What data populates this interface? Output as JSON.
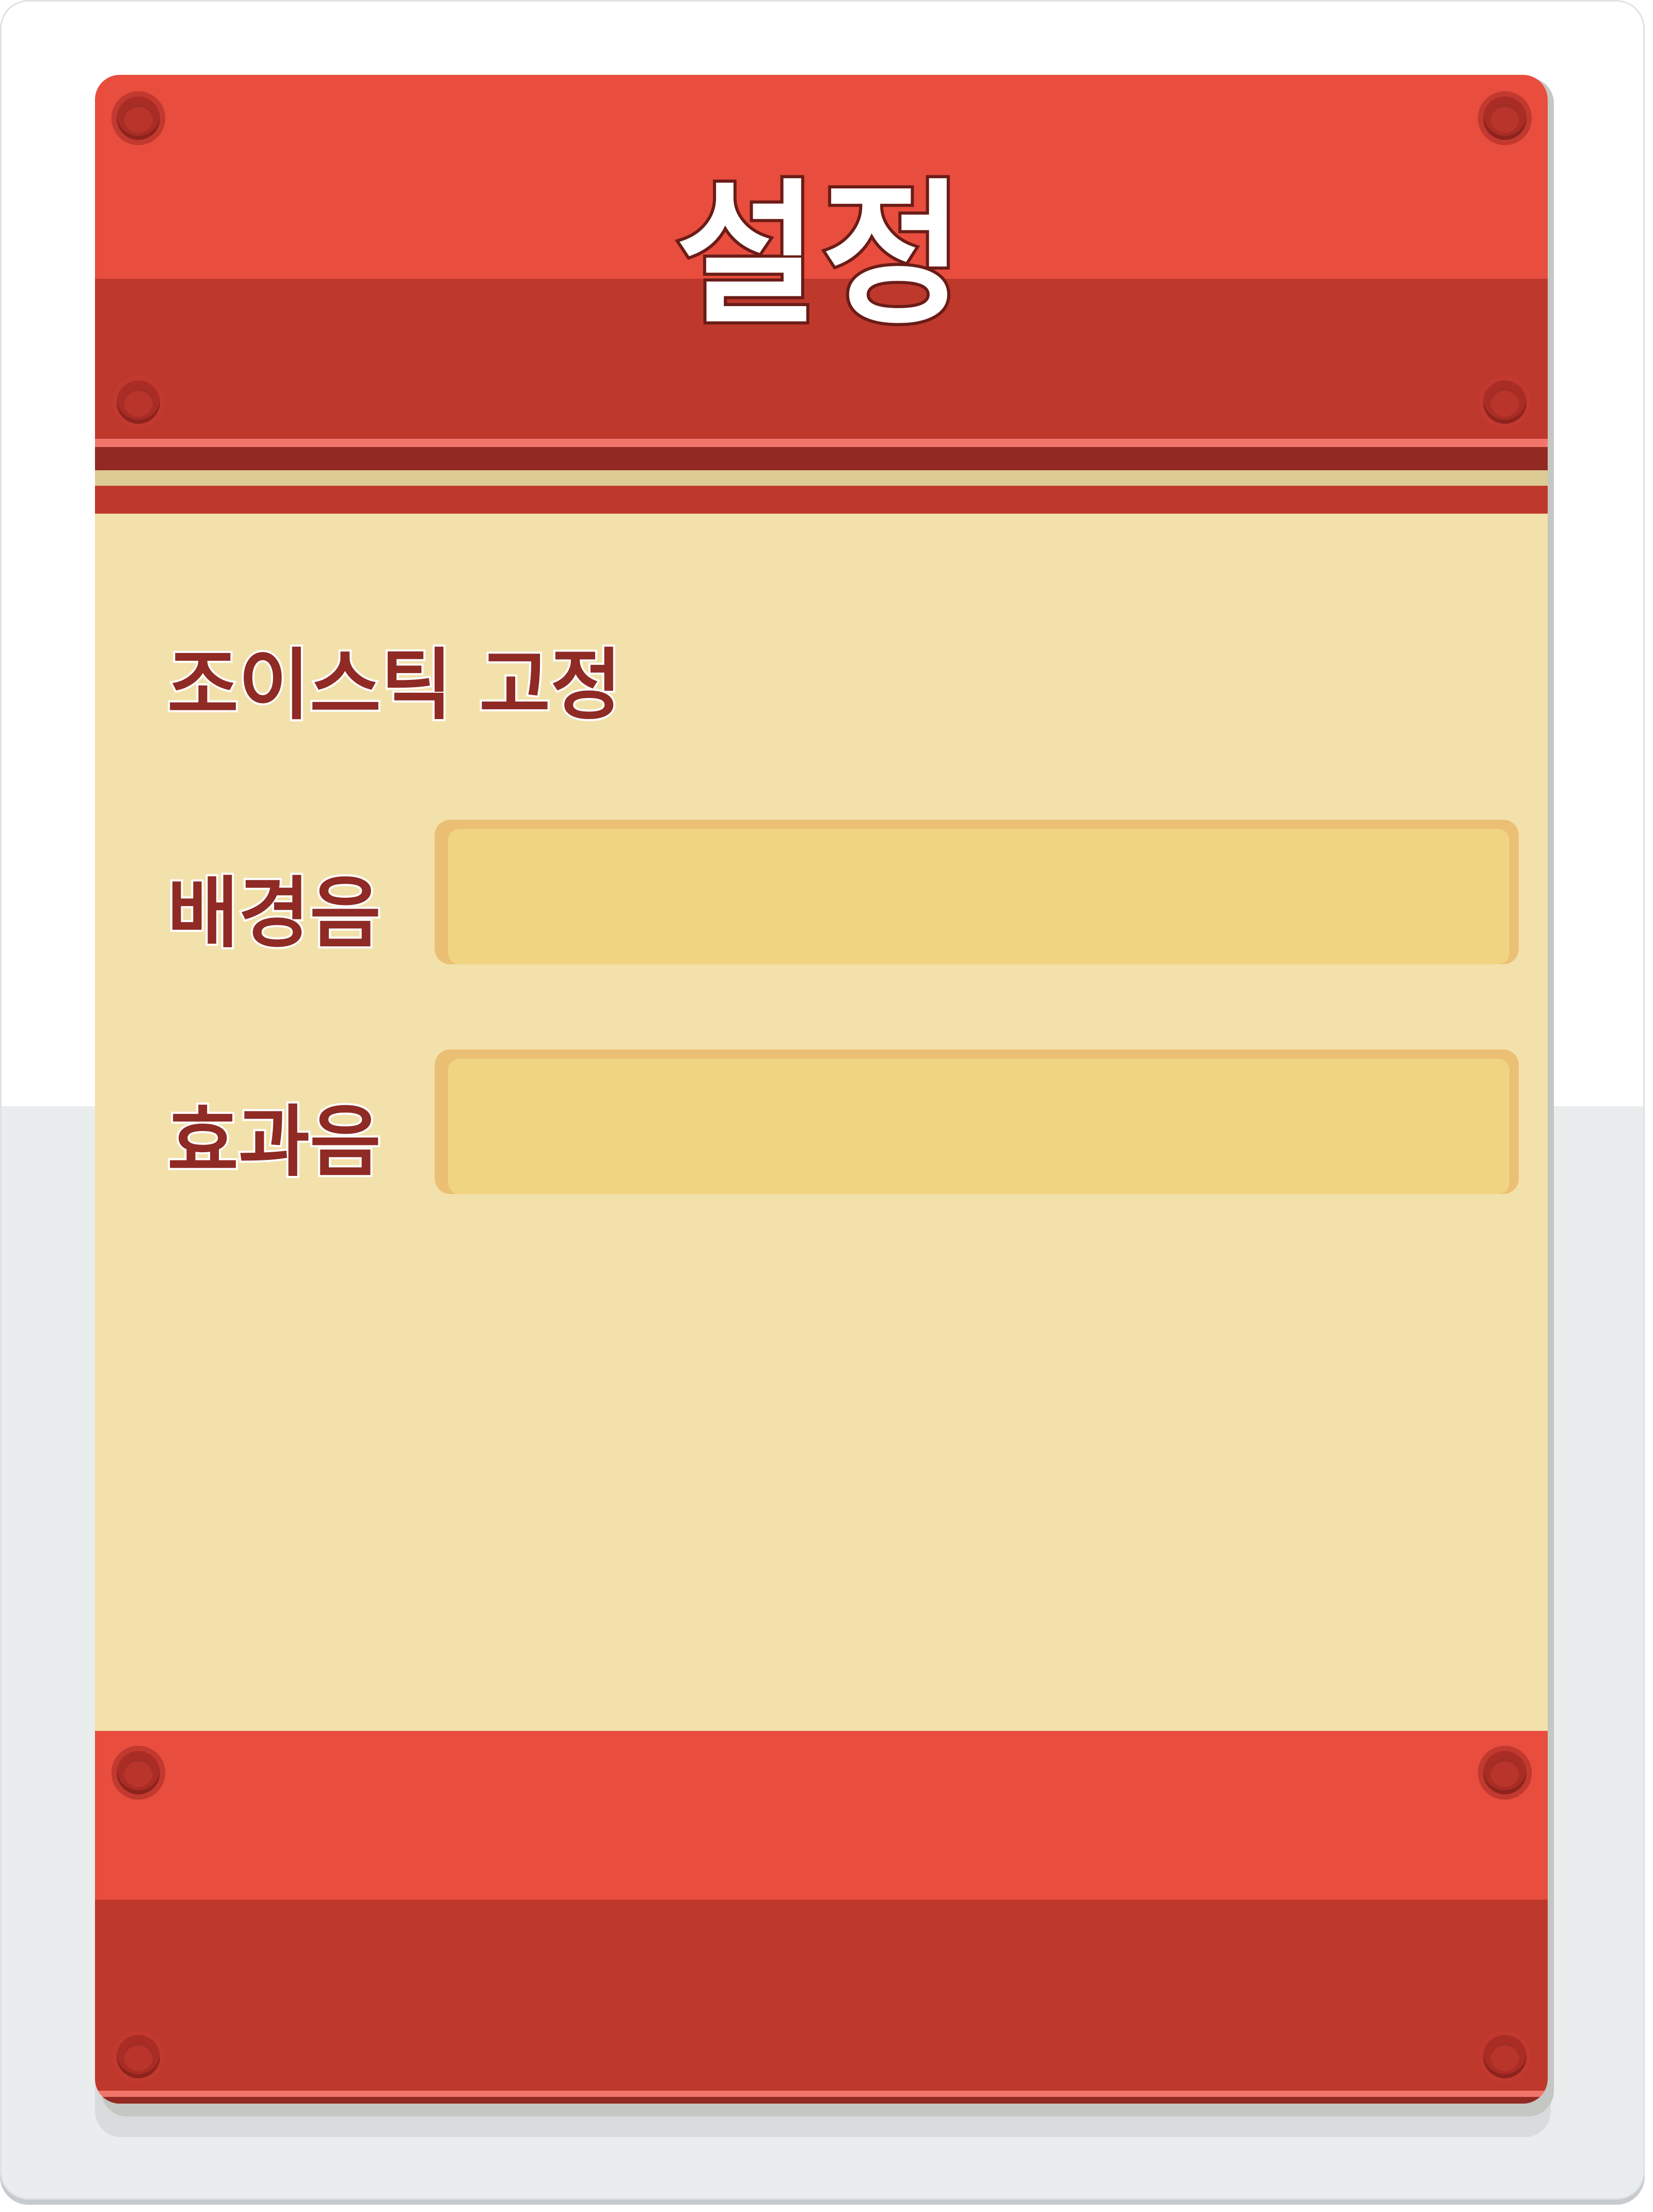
{
  "settings_panel": {
    "title": "설정",
    "joystick_lock_label": "조이스틱 고정",
    "bgm_label": "배경음",
    "sfx_label": "효과음",
    "bgm_volume": 1.0,
    "sfx_volume": 1.0
  },
  "colors": {
    "header_red": "#e84d3e",
    "header_dark_red": "#bf382c",
    "panel_cream": "#f3e1ab",
    "label_text": "#8f2a24",
    "slider_track": "#ebc075",
    "slider_fill": "#f0d482"
  }
}
